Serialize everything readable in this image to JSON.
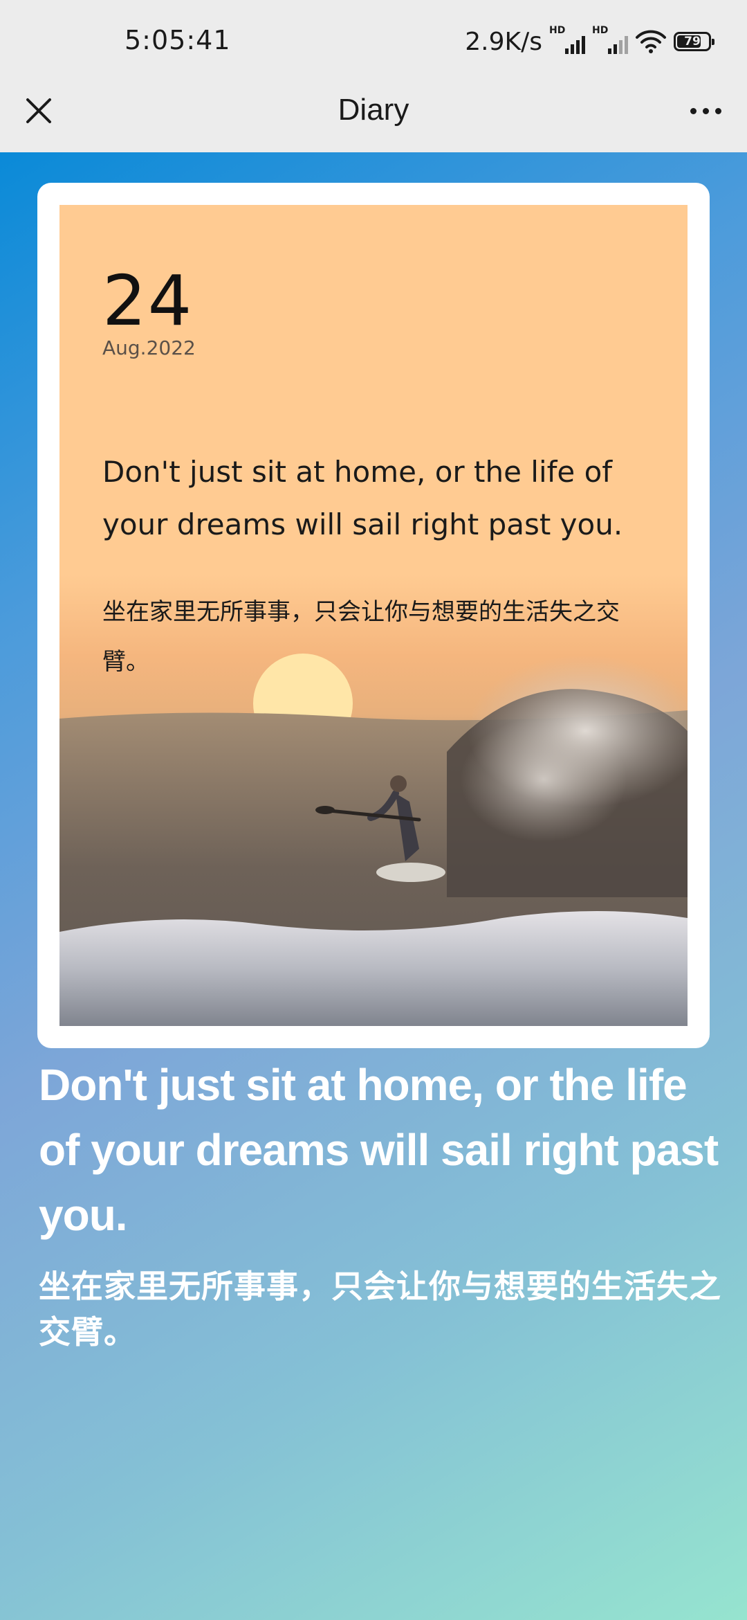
{
  "status_bar": {
    "time": "5:05:41",
    "net_speed": "2.9K/s",
    "signal_1_label": "HD",
    "signal_2_label": "HD",
    "battery": "79",
    "battery_level": 0.79,
    "icons": [
      "signal-hd-icon",
      "signal-hd-icon",
      "wifi-icon",
      "battery-icon"
    ]
  },
  "header": {
    "title": "Diary",
    "close_icon": "close-icon",
    "more_icon": "more-icon"
  },
  "card": {
    "day": "24",
    "month_year": "Aug.2022",
    "quote_en": "Don't just sit at home, or the life of your dreams will sail right past you.",
    "quote_zh": "坐在家里无所事事，只会让你与想要的生活失之交臂。",
    "image": "surfer-at-sunset-photo"
  },
  "main": {
    "quote_en": "Don't just sit at home, or the life of your dreams will sail right past you.",
    "quote_zh": "坐在家里无所事事，只会让你与想要的生活失之交臂。"
  },
  "colors": {
    "gradient_start": "#0a8ad8",
    "gradient_end": "#96e4cf",
    "card_bg": "#ffcb92"
  }
}
